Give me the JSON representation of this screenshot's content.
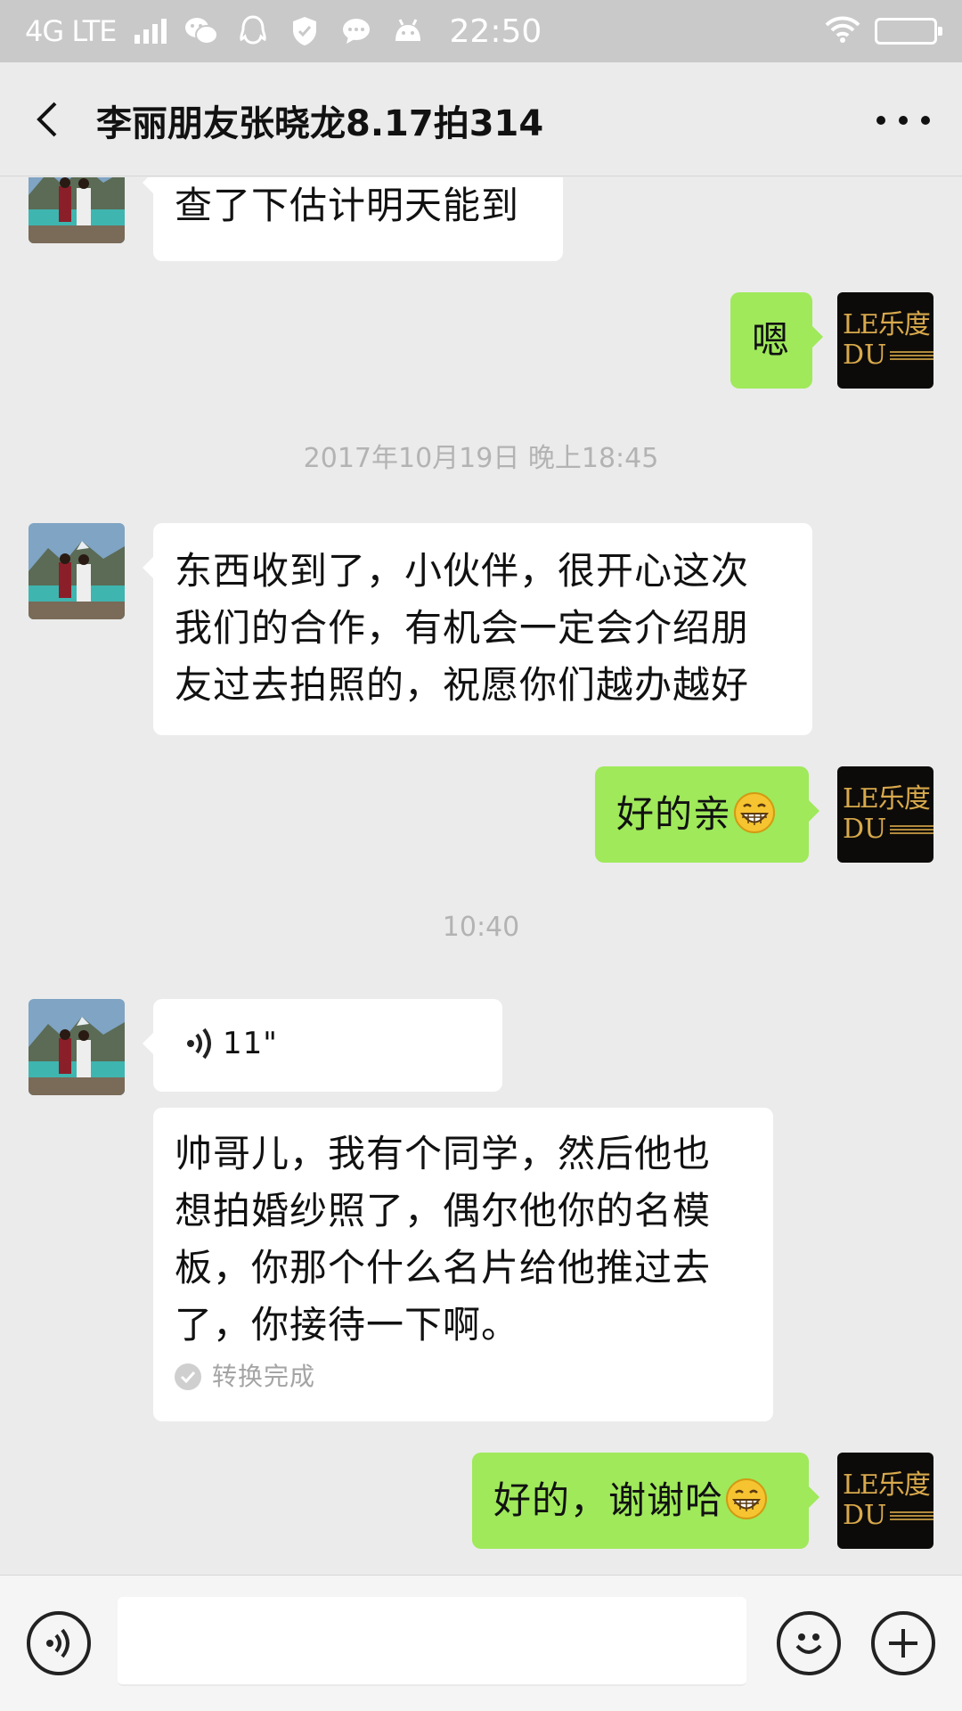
{
  "status_bar": {
    "network": "4G LTE",
    "time": "22:50",
    "icons": [
      "signal-icon",
      "wechat-icon",
      "qq-icon",
      "shield-icon",
      "message-icon",
      "android-icon",
      "wifi-icon",
      "battery-icon"
    ]
  },
  "header": {
    "title": "李丽朋友张晓龙8.17拍314",
    "back_icon": "chevron-left-icon",
    "more_icon": "more-dots-icon"
  },
  "contact_avatar": {
    "description_icon": "photo-avatar"
  },
  "brand_avatar": {
    "line1": "LE乐度",
    "line2": "DU"
  },
  "messages": [
    {
      "side": "in",
      "text": "查了下估计明天能到"
    },
    {
      "side": "out",
      "text": "嗯"
    },
    {
      "type": "timestamp",
      "text": "2017年10月19日 晚上18:45"
    },
    {
      "side": "in",
      "lines": [
        "东西收到了，小伙伴，很开心这次",
        "我们的合作，有机会一定会介绍朋",
        "友过去拍照的，祝愿你们越办越好"
      ]
    },
    {
      "side": "out",
      "text": "好的亲",
      "emoji": "grin-emoji"
    },
    {
      "type": "timestamp",
      "text": "10:40"
    },
    {
      "side": "in",
      "type": "voice",
      "duration": "11\""
    },
    {
      "side": "in",
      "type": "voice-transcript",
      "lines": [
        "帅哥儿，我有个同学，然后他也",
        "想拍婚纱照了，偶尔他你的名模",
        "板，你那个什么名片给他推过去",
        "了，你接待一下啊。"
      ],
      "status": "转换完成"
    },
    {
      "side": "out",
      "text": "好的，谢谢哈",
      "emoji": "grin-emoji"
    }
  ],
  "input_bar": {
    "voice_icon": "voice-mode-icon",
    "emoji_icon": "emoji-icon",
    "plus_icon": "plus-icon"
  },
  "colors": {
    "outgoing_bubble": "#9fe95a",
    "incoming_bubble": "#ffffff",
    "background": "#ebebeb",
    "status_bar": "#c9c9c9"
  }
}
